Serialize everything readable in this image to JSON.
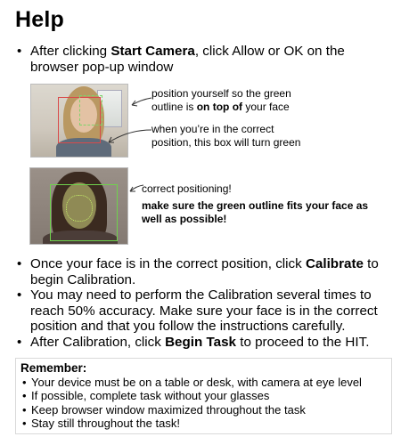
{
  "title": "Help",
  "bullets": {
    "b1": {
      "pre": "After clicking ",
      "bold": "Start Camera",
      "post": ", click Allow or OK on the browser pop-up window"
    },
    "b2": {
      "pre": "Once your face is in the correct position, click ",
      "bold": "Calibrate",
      "post": " to begin Calibration."
    },
    "b3": {
      "text": "You may need to perform the Calibration several times to reach 50% accuracy. Make sure your face is in the correct position and that you follow the instructions carefully."
    },
    "b4": {
      "pre": "After Calibration, click ",
      "bold": "Begin Task",
      "post": " to proceed to the HIT."
    }
  },
  "notes": {
    "n1_line1": "position yourself so the green",
    "n1_line2_pre": "outline is ",
    "n1_line2_bold": "on top of",
    "n1_line2_post": " your face",
    "n2_line1": "when you’re in the correct",
    "n2_line2": "position, this box will turn green",
    "n3": "correct positioning!",
    "n4_line1": "make sure the green outline fits your face as",
    "n4_line2": "well as possible!"
  },
  "remember": {
    "title": "Remember:",
    "items": [
      "Your device must be on a table or desk, with camera at eye level",
      "If possible, complete task without your glasses",
      "Keep browser window maximized throughout the task",
      "Stay still throughout the task!"
    ]
  }
}
